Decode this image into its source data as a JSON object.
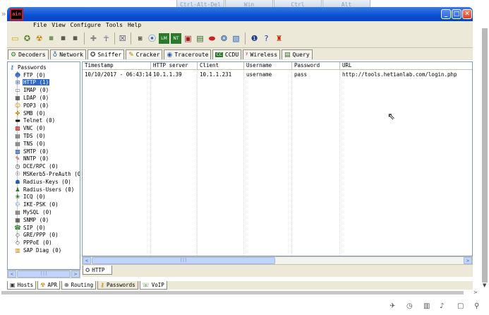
{
  "rdp": {
    "left_arrow": "»",
    "keys": [
      "Ctrl-Alt-Del",
      "Win",
      "Ctrl",
      "Alt"
    ]
  },
  "app": {
    "icon_text": "ain",
    "window_buttons": {
      "minimize": "_",
      "maximize": "□",
      "close": "✕"
    }
  },
  "menubar": [
    "File",
    "View",
    "Configure",
    "Tools",
    "Help"
  ],
  "toolbar_icons": [
    "open-folder-icon",
    "start-sniffer-icon",
    "start-apr-icon",
    "hash-calc-1-icon",
    "hash-calc-2-icon",
    "hash-calc-3-icon",
    "add-icon",
    "remove-icon",
    "certificate-icon",
    "route-icon",
    "wireless-icon",
    "calc-icon",
    "hash-table-icon",
    "mail-icon",
    "record-icon",
    "network-icon",
    "edit-icon",
    "info-icon",
    "help-icon",
    "cain-logo-icon"
  ],
  "main_tabs": [
    {
      "label": "Decoders",
      "icon": "decoders-icon"
    },
    {
      "label": "Network",
      "icon": "network-icon"
    },
    {
      "label": "Sniffer",
      "icon": "sniffer-icon",
      "active": true
    },
    {
      "label": "Cracker",
      "icon": "cracker-icon"
    },
    {
      "label": "Traceroute",
      "icon": "traceroute-icon"
    },
    {
      "label": "CCDU",
      "icon": "ccdu-icon"
    },
    {
      "label": "Wireless",
      "icon": "wireless-icon"
    },
    {
      "label": "Query",
      "icon": "query-icon"
    }
  ],
  "tree": {
    "root": "Passwords",
    "items": [
      "FTP (0)",
      "HTTP (1)",
      "IMAP (0)",
      "LDAP (0)",
      "POP3 (0)",
      "SMB (0)",
      "Telnet (0)",
      "VNC (0)",
      "TDS (0)",
      "TNS (0)",
      "SMTP (0)",
      "NNTP (0)",
      "DCE/RPC (0)",
      "MSKerb5-PreAuth (0",
      "Radius-Keys (0)",
      "Radius-Users (0)",
      "ICQ (0)",
      "IKE-PSK (0)",
      "MySQL (0)",
      "SNMP (0)",
      "SIP (0)",
      "GRE/PPP (0)",
      "PPPoE (0)",
      "SAP Diag (0)"
    ],
    "selected_index": 1
  },
  "grid": {
    "columns": [
      "Timestamp",
      "HTTP server",
      "Client",
      "Username",
      "Password",
      "URL"
    ],
    "rows": [
      [
        "10/10/2017 - 06:43:14",
        "10.1.1.39",
        "10.1.1.231",
        "username",
        "pass",
        "http://tools.hetianlab.com/login.php"
      ]
    ]
  },
  "sub_tab": {
    "label": "HTTP"
  },
  "bottom_tabs": [
    {
      "label": "Hosts",
      "icon": "hosts-icon"
    },
    {
      "label": "APR",
      "icon": "apr-icon"
    },
    {
      "label": "Routing",
      "icon": "routing-icon"
    },
    {
      "label": "Passwords",
      "icon": "passwords-icon"
    },
    {
      "label": "VoIP",
      "icon": "voip-icon"
    }
  ],
  "scroll": {
    "left": "<",
    "right": ">",
    "up": "▲",
    "down": "▼",
    "grip": "|||"
  }
}
